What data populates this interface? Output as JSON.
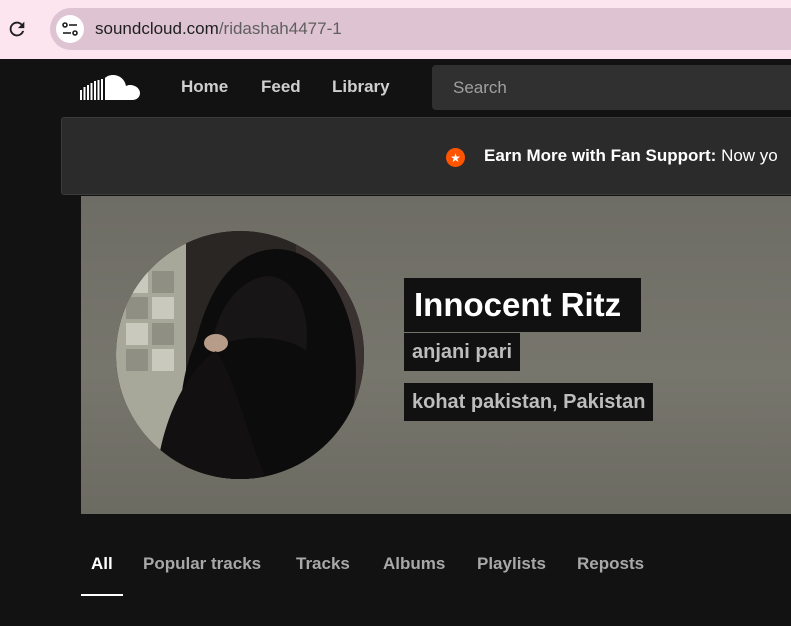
{
  "browser": {
    "url_host": "soundcloud.com",
    "url_path": "/ridashah4477-1"
  },
  "header": {
    "nav": [
      {
        "label": "Home"
      },
      {
        "label": "Feed"
      },
      {
        "label": "Library"
      }
    ],
    "search_placeholder": "Search"
  },
  "banner": {
    "strong": "Earn More with Fan Support:",
    "text": " Now yo"
  },
  "profile": {
    "name": "Innocent Ritz",
    "subtitle": "anjani pari",
    "location": "kohat pakistan, Pakistan"
  },
  "tabs": [
    {
      "label": "All",
      "active": true
    },
    {
      "label": "Popular tracks"
    },
    {
      "label": "Tracks"
    },
    {
      "label": "Albums"
    },
    {
      "label": "Playlists"
    },
    {
      "label": "Reposts"
    }
  ],
  "colors": {
    "accent": "#ff5500",
    "background": "#121212"
  }
}
